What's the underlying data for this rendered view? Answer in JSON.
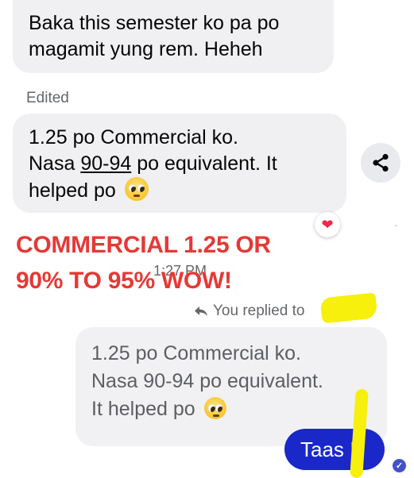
{
  "messages": {
    "first": {
      "text_line1": "Baka this semester ko pa po",
      "text_line2": "magamit yung rem. Heheh"
    },
    "edited_label": "Edited",
    "second": {
      "line1": "1.25 po Commercial ko.",
      "line2_prefix": "Nasa ",
      "line2_link": "90-94",
      "line2_suffix": " po equivalent. It",
      "line3": "helped po",
      "emoji": "pleading-face-icon"
    },
    "reaction": "heart-icon",
    "overlay_line1": "COMMERCIAL 1.25 OR",
    "overlay_line2": "90% TO 95% WOW!",
    "timestamp": "1:27 PM",
    "replied_label": "You replied to",
    "quoted": {
      "line1": "1.25 po Commercial ko.",
      "line2": "Nasa 90-94 po equivalent.",
      "line3": "It helped po"
    },
    "outgoing": "Taas !!"
  },
  "colors": {
    "incoming_bubble": "#f0f0f2",
    "outgoing_bubble": "#1a28c9",
    "overlay_text": "#e53935",
    "highlighter": "#f7ef0c",
    "heart": "#f02849"
  }
}
